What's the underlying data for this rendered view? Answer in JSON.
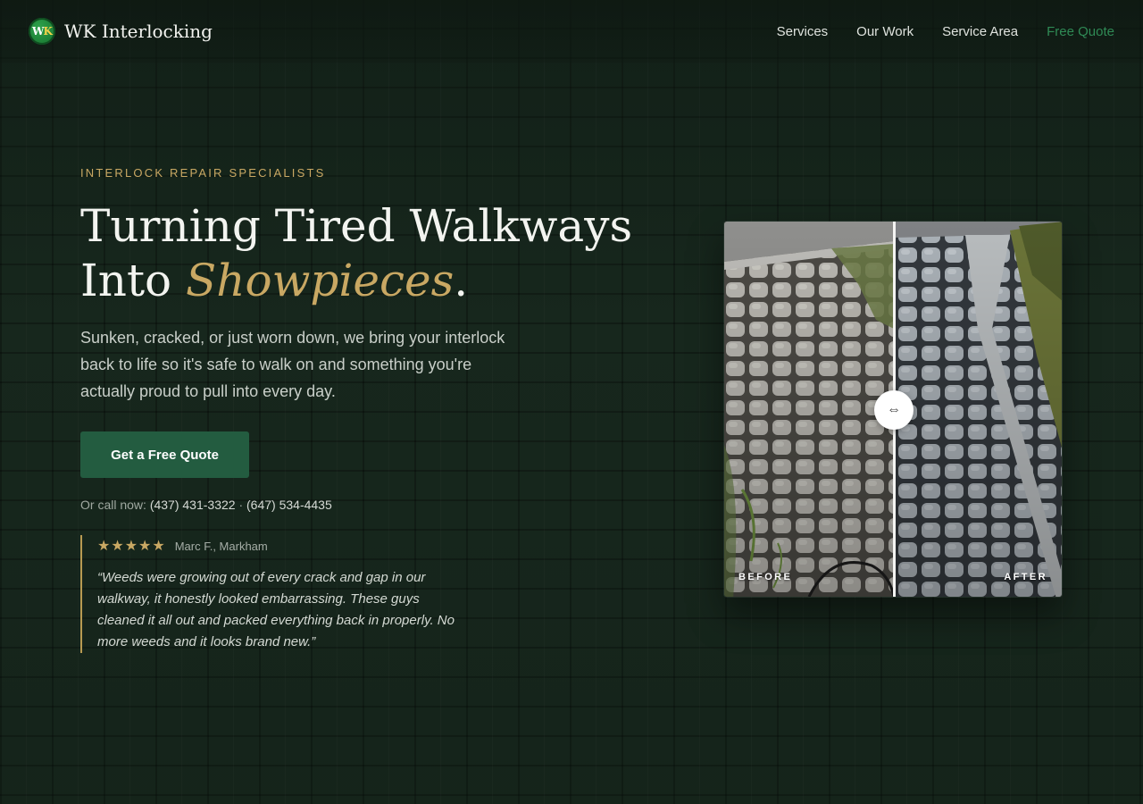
{
  "header": {
    "logo_text": "WK",
    "brand_name": "WK Interlocking",
    "nav": [
      {
        "label": "Services"
      },
      {
        "label": "Our Work"
      },
      {
        "label": "Service Area"
      },
      {
        "label": "Free Quote"
      }
    ]
  },
  "hero": {
    "eyebrow": "INTERLOCK REPAIR SPECIALISTS",
    "headline_line1": "Turning Tired Walkways",
    "headline_line2_prefix": "Into ",
    "headline_accent": "Showpieces",
    "headline_suffix": ".",
    "lede": "Sunken, cracked, or just worn down, we bring your interlock back to life so it's safe to walk on and something you're actually proud to pull into every day.",
    "cta_label": "Get a Free Quote",
    "call_prefix": "Or call now: ",
    "phone_1": "(437) 431-3322",
    "call_separator": " · ",
    "phone_2": "(647) 534-4435"
  },
  "review": {
    "stars": "★★★★★",
    "rating": 5,
    "reviewer": "Marc F., Markham",
    "text": "“Weeds were growing out of every crack and gap in our walkway, it honestly looked embarrassing. These guys cleaned it all out and packed everything back in properly. No more weeds and it looks brand new.”"
  },
  "compare": {
    "before_label": "BEFORE",
    "after_label": "AFTER",
    "handle_icon": "⇔",
    "slider_position": 0.5
  },
  "colors": {
    "accent_gold": "#c9a863",
    "brand_green": "#235c40",
    "nav_quote_green": "#2f8a55",
    "background": "#17271d"
  }
}
